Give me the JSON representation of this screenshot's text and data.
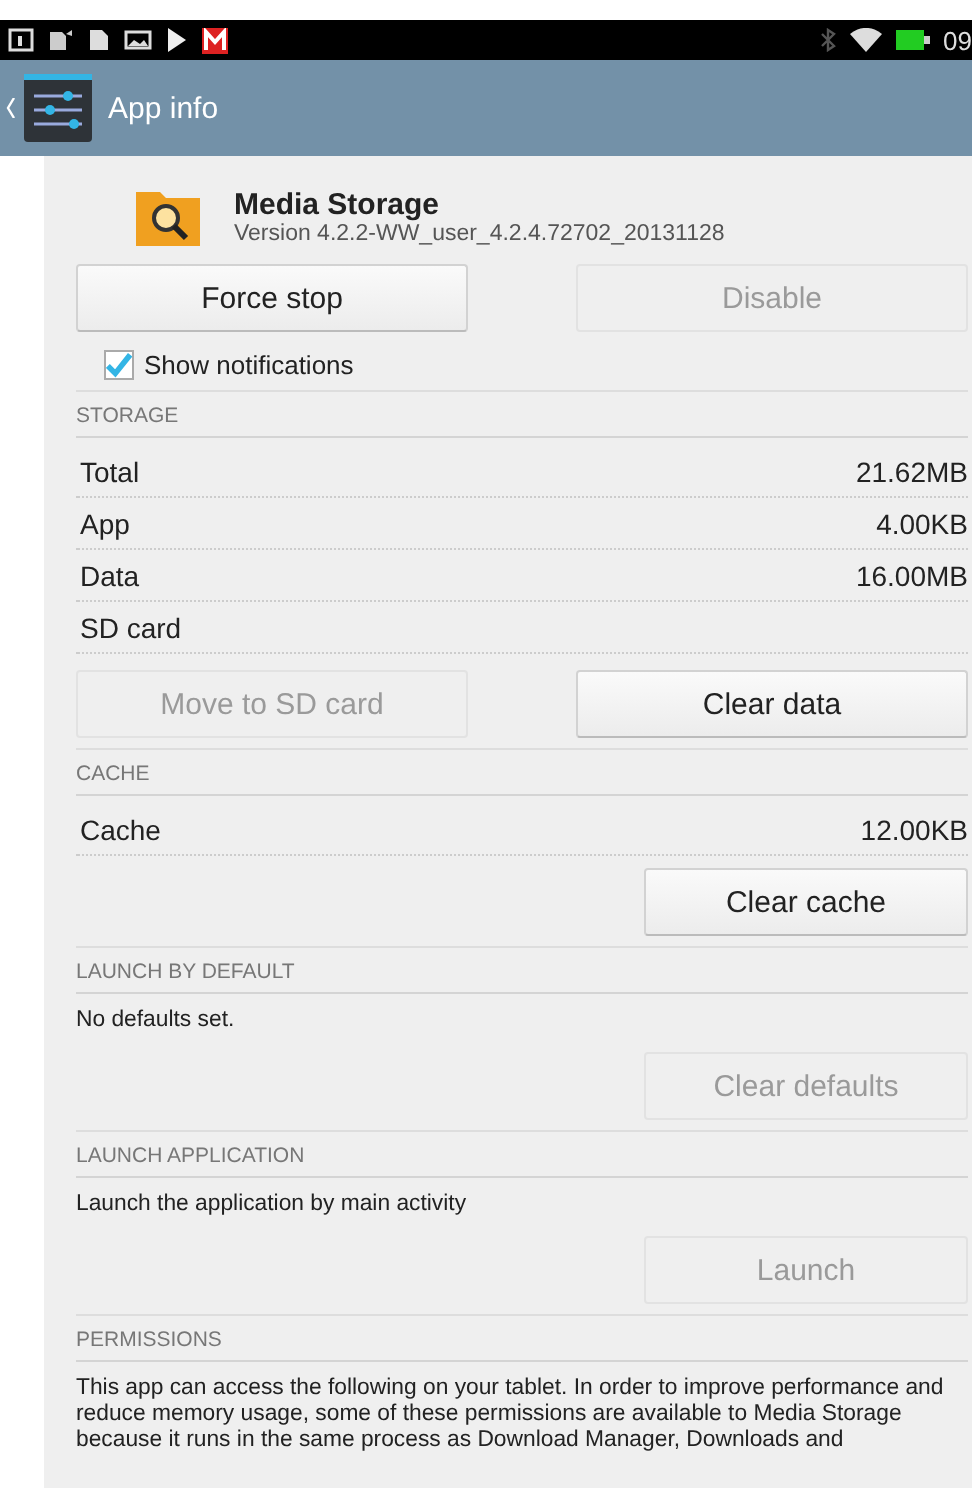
{
  "status_bar": {
    "time": "09"
  },
  "action_bar": {
    "title": "App info"
  },
  "app": {
    "name": "Media Storage",
    "version": "Version 4.2.2-WW_user_4.2.4.72702_20131128"
  },
  "top_buttons": [
    {
      "label": "Force stop",
      "disabled": false
    },
    {
      "label": "Disable",
      "disabled": true
    }
  ],
  "show_notifications": {
    "label": "Show notifications",
    "checked": true
  },
  "sections": [
    {
      "header": "STORAGE",
      "rows": [
        {
          "label": "Total",
          "value": "21.62MB"
        },
        {
          "label": "App",
          "value": "4.00KB"
        },
        {
          "label": "Data",
          "value": "16.00MB"
        },
        {
          "label": "SD card"
        }
      ],
      "buttons": [
        {
          "label": "Move to SD card",
          "disabled": true
        },
        {
          "label": "Clear data",
          "disabled": false
        }
      ]
    },
    {
      "header": "CACHE",
      "rows": [
        {
          "label": "Cache",
          "value": "12.00KB"
        }
      ],
      "buttons": [
        {
          "label": "Clear cache",
          "disabled": false
        }
      ]
    },
    {
      "header": "LAUNCH BY DEFAULT",
      "note": "No defaults set.",
      "buttons": [
        {
          "label": "Clear defaults",
          "disabled": true
        }
      ]
    },
    {
      "header": "LAUNCH APPLICATION",
      "note": "Launch the application by main activity",
      "buttons": [
        {
          "label": "Launch",
          "disabled": true
        }
      ]
    },
    {
      "header": "PERMISSIONS",
      "note": "This app can access the following on your tablet. In order to improve performance and reduce memory usage, some of these permissions are available to Media Storage because it runs in the same process as Download Manager, Downloads and"
    }
  ]
}
